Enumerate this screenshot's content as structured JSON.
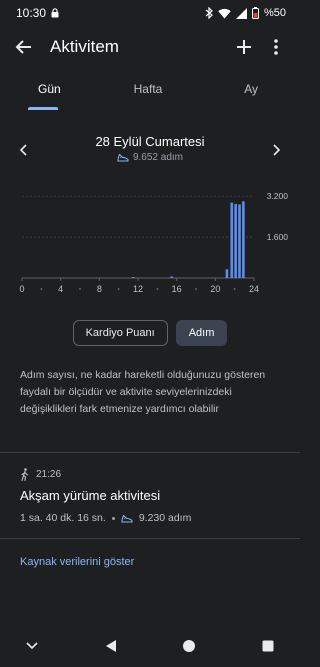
{
  "status_bar": {
    "time": "10:30",
    "battery": "%50",
    "icons": [
      "lock-icon",
      "bluetooth-icon",
      "wifi-icon",
      "signal-icon",
      "battery-icon"
    ]
  },
  "app_bar": {
    "title": "Aktivitem",
    "icons": [
      "back-arrow-icon",
      "plus-icon",
      "more-vert-icon"
    ]
  },
  "tabs": [
    {
      "label": "Gün",
      "active": true
    },
    {
      "label": "Hafta",
      "active": false
    },
    {
      "label": "Ay",
      "active": false
    }
  ],
  "date_nav": {
    "title": "28 Eylül Cumartesi",
    "steps": "9.652 adım"
  },
  "chart_data": {
    "type": "bar",
    "x_ticks": [
      "0",
      "4",
      "8",
      "12",
      "16",
      "20",
      "24"
    ],
    "y_ticks": [
      "1.600",
      "3.200"
    ],
    "ylim": [
      0,
      3600
    ],
    "bar_color": "#5b8def",
    "bars": [
      {
        "x": 11.5,
        "value": 40
      },
      {
        "x": 15.5,
        "value": 60
      },
      {
        "x": 21.2,
        "value": 340
      },
      {
        "x": 21.7,
        "value": 2950
      },
      {
        "x": 22.1,
        "value": 2900
      },
      {
        "x": 22.5,
        "value": 2880
      },
      {
        "x": 22.9,
        "value": 3000
      }
    ]
  },
  "toggle": {
    "options": [
      {
        "label": "Kardiyo Puanı",
        "selected": false
      },
      {
        "label": "Adım",
        "selected": true
      }
    ]
  },
  "description": "Adım sayısı, ne kadar hareketli olduğunuzu gösteren faydalı bir ölçüdür ve aktivite seviyelerinizdeki değişiklikleri fark etmenize yardımcı olabilir",
  "activity": {
    "time": "21:26",
    "title": "Akşam yürüme aktivitesi",
    "duration": "1 sa. 40 dk. 16 sn.",
    "steps": "9.230 adım"
  },
  "source_link": "Kaynak verilerini göster",
  "nav_bar": [
    "chevron-down-icon",
    "back-triangle-icon",
    "home-circle-icon",
    "recents-square-icon"
  ],
  "colors": {
    "background": "#1e1f21",
    "accent": "#8ab4f8",
    "bar": "#5b8def"
  }
}
